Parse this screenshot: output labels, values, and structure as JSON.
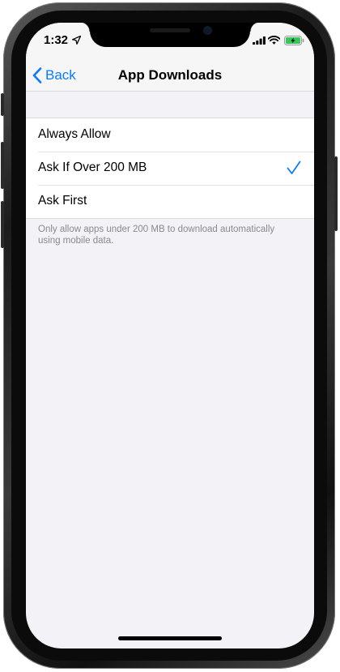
{
  "status_bar": {
    "time": "1:32",
    "icons": [
      "location-arrow-icon",
      "cellular-signal-icon",
      "wifi-icon",
      "battery-charging-icon"
    ]
  },
  "nav": {
    "back_label": "Back",
    "title": "App Downloads"
  },
  "options": [
    {
      "label": "Always Allow",
      "selected": false
    },
    {
      "label": "Ask If Over 200 MB",
      "selected": true
    },
    {
      "label": "Ask First",
      "selected": false
    }
  ],
  "footnote": "Only allow apps under 200 MB to download automatically using mobile data.",
  "colors": {
    "accent": "#0a7aff",
    "background": "#f2f2f7",
    "battery_charge": "#34c759"
  }
}
